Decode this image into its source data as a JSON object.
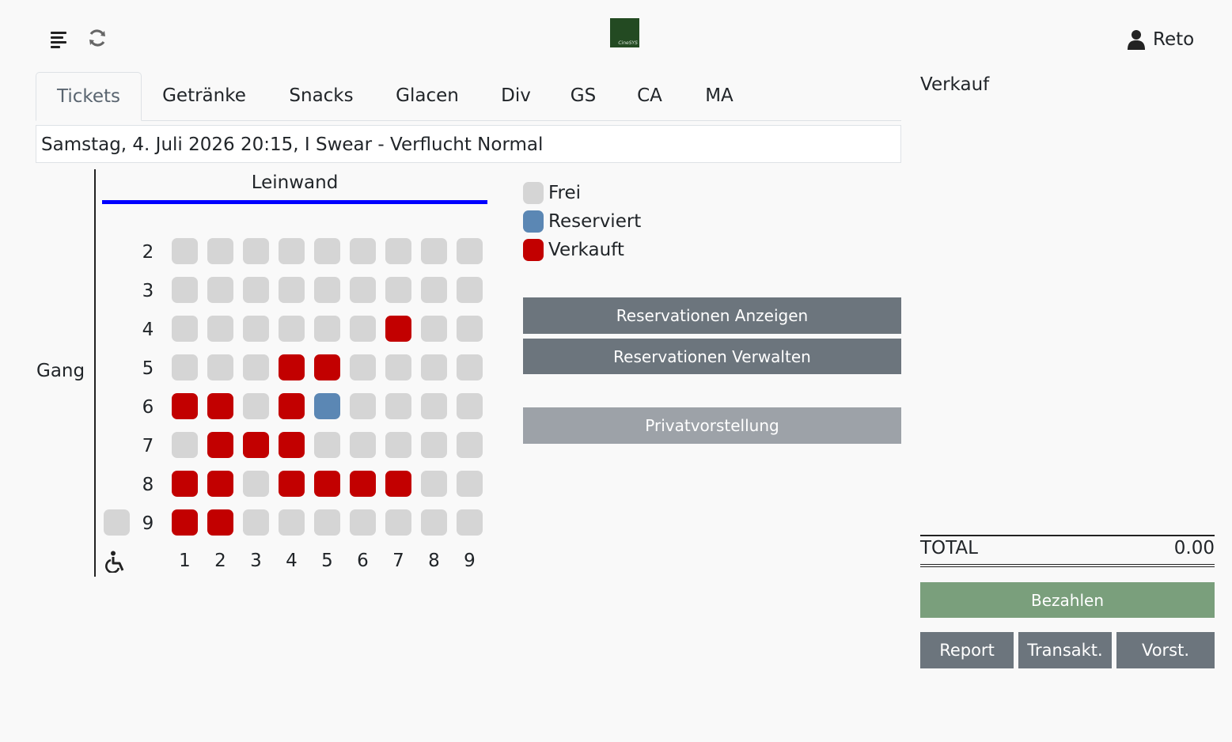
{
  "header": {
    "menu_icon": "menu-lines-icon",
    "refresh_icon": "refresh-icon",
    "logo_text": "CineSYS",
    "user_icon": "user-icon",
    "user_name": "Reto"
  },
  "tabs": [
    {
      "label": "Tickets",
      "active": true
    },
    {
      "label": "Getränke",
      "active": false
    },
    {
      "label": "Snacks",
      "active": false
    },
    {
      "label": "Glacen",
      "active": false
    },
    {
      "label": "Div",
      "active": false
    },
    {
      "label": "GS",
      "active": false
    },
    {
      "label": "CA",
      "active": false
    },
    {
      "label": "MA",
      "active": false
    }
  ],
  "show": {
    "selected": "Samstag, 4. Juli 2026 20:15, I Swear - Verflucht Normal"
  },
  "seatplan": {
    "screen_label": "Leinwand",
    "aisle_label": "Gang",
    "wheelchair_icon": "wheelchair-icon",
    "columns": [
      "1",
      "2",
      "3",
      "4",
      "5",
      "6",
      "7",
      "8",
      "9"
    ],
    "rows": [
      {
        "label": "2",
        "seats": [
          "F",
          "F",
          "F",
          "F",
          "F",
          "F",
          "F",
          "F",
          "F"
        ]
      },
      {
        "label": "3",
        "seats": [
          "F",
          "F",
          "F",
          "F",
          "F",
          "F",
          "F",
          "F",
          "F"
        ]
      },
      {
        "label": "4",
        "seats": [
          "F",
          "F",
          "F",
          "F",
          "F",
          "F",
          "S",
          "F",
          "F"
        ]
      },
      {
        "label": "5",
        "seats": [
          "F",
          "F",
          "F",
          "S",
          "S",
          "F",
          "F",
          "F",
          "F"
        ]
      },
      {
        "label": "6",
        "seats": [
          "S",
          "S",
          "F",
          "S",
          "R",
          "F",
          "F",
          "F",
          "F"
        ]
      },
      {
        "label": "7",
        "seats": [
          "F",
          "S",
          "S",
          "S",
          "F",
          "F",
          "F",
          "F",
          "F"
        ]
      },
      {
        "label": "8",
        "seats": [
          "S",
          "S",
          "F",
          "S",
          "S",
          "S",
          "S",
          "F",
          "F"
        ]
      },
      {
        "label": "9",
        "seats": [
          "S",
          "S",
          "F",
          "F",
          "F",
          "F",
          "F",
          "F",
          "F"
        ]
      }
    ],
    "wheelchair_seat_row": "9",
    "wheelchair_seat_status": "F"
  },
  "legend": [
    {
      "label": "Frei",
      "color": "#d5d5d5"
    },
    {
      "label": "Reserviert",
      "color": "#5b87b4"
    },
    {
      "label": "Verkauft",
      "color": "#c20000"
    }
  ],
  "actions": {
    "show_reservations": "Reservationen Anzeigen",
    "manage_reservations": "Reservationen Verwalten",
    "private_show": "Privatvorstellung"
  },
  "sale": {
    "title": "Verkauf",
    "total_label": "TOTAL",
    "total_value": "0.00",
    "pay_button": "Bezahlen",
    "report_button": "Report",
    "transactions_button": "Transakt.",
    "presets_button": "Vorst."
  },
  "colors": {
    "free": "#d5d5d5",
    "reserved": "#5b87b4",
    "sold": "#c20000",
    "screen": "#0000ff",
    "button_dark": "#6c757d",
    "button_pay": "#7a9f7c"
  }
}
